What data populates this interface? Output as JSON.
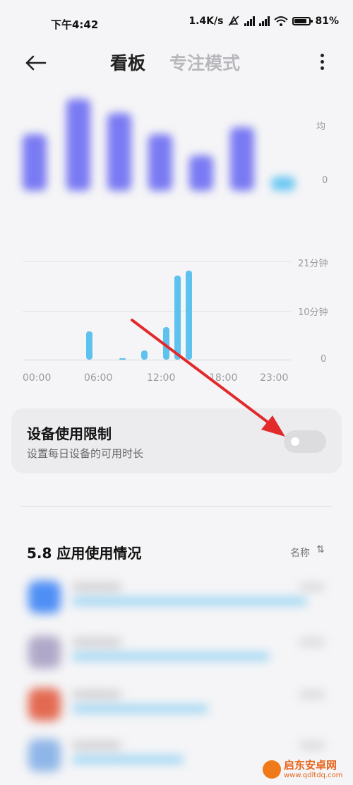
{
  "status_bar": {
    "time": "下午4:42",
    "net_speed": "1.4K/s",
    "battery": "81%"
  },
  "header": {
    "tab_board": "看板",
    "tab_focus": "专注模式"
  },
  "weekly_chart": {
    "top_label": "均",
    "zero_label": "0",
    "bar_color": "#7a7af3",
    "today_color": "#6cc7f3"
  },
  "hourly_chart": {
    "y_labels": [
      "21分钟",
      "10分钟",
      "0"
    ],
    "x_labels": [
      "00:00",
      "06:00",
      "12:00",
      "18:00",
      "23:00"
    ],
    "bar_color": "#5ec2ee"
  },
  "chart_data": {
    "type": "bar",
    "title": "",
    "xlabel": "",
    "ylabel": "",
    "ylim": [
      0,
      21
    ],
    "categories": [
      "06:00",
      "09:00",
      "11:00",
      "13:00",
      "14:00",
      "15:00"
    ],
    "values": [
      6,
      0.2,
      2,
      7,
      18,
      19
    ]
  },
  "limit_card": {
    "title": "设备使用限制",
    "subtitle": "设置每日设备的可用时长",
    "enabled": false
  },
  "apps": {
    "title": "5.8 应用使用情况",
    "sort_label": "名称",
    "sort_icon": "⇅",
    "rows": [
      {
        "icon_color": "#4f8ff5",
        "usage": 0.95
      },
      {
        "icon_color": "#b0a8c8",
        "usage": 0.8
      },
      {
        "icon_color": "#e36a52",
        "usage": 0.55
      },
      {
        "icon_color": "#8fb6e8",
        "usage": 0.45
      }
    ]
  },
  "watermark": {
    "line1": "启东安卓网",
    "line2": "www.qdltdq.com"
  }
}
